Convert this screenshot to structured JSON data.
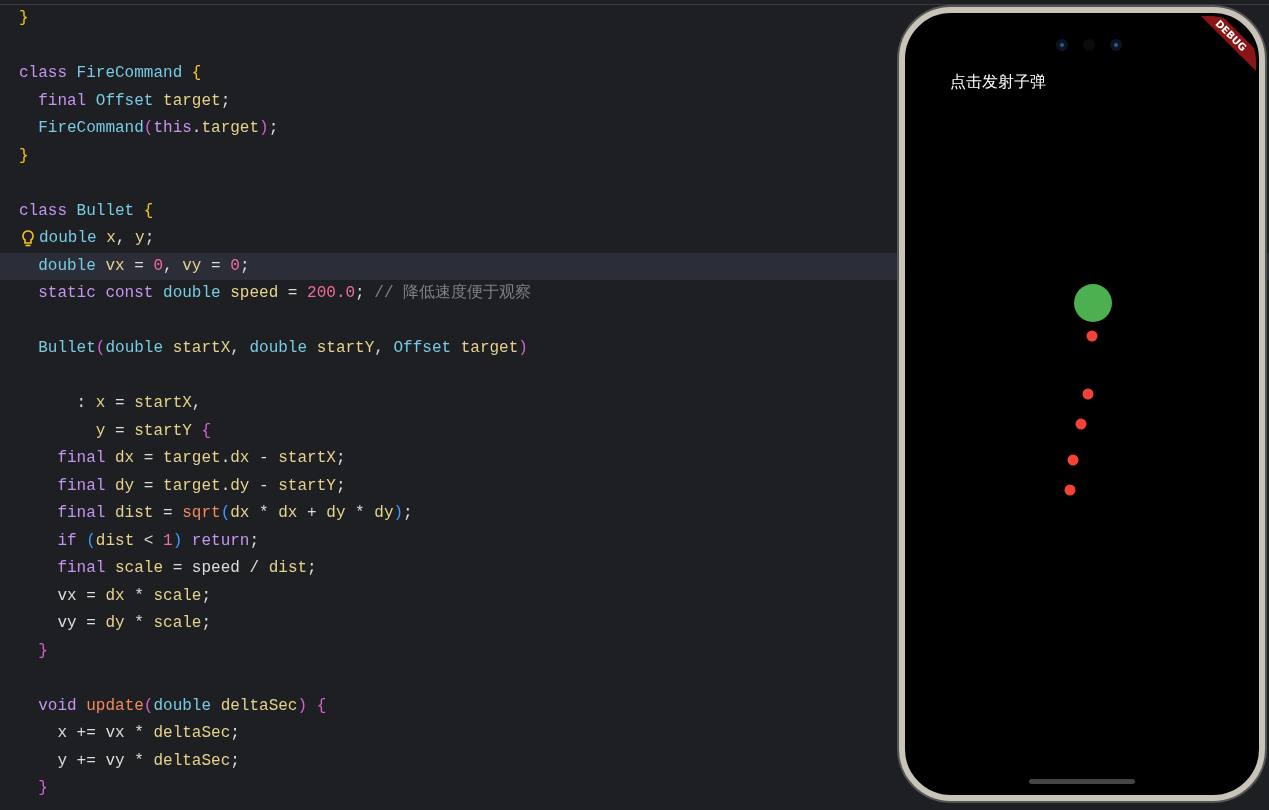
{
  "editor": {
    "lines": [
      {
        "kind": "code",
        "tokens": [
          {
            "t": "}",
            "kind": "brace"
          }
        ]
      },
      {
        "kind": "blank"
      },
      {
        "kind": "code",
        "tokens": [
          {
            "t": "class ",
            "kind": "kw"
          },
          {
            "t": "FireCommand ",
            "kind": "type"
          },
          {
            "t": "{",
            "kind": "brace"
          }
        ]
      },
      {
        "kind": "code",
        "tokens": [
          {
            "t": "  final ",
            "kind": "kw"
          },
          {
            "t": "Offset ",
            "kind": "type"
          },
          {
            "t": "target",
            "kind": "id"
          },
          {
            "t": ";",
            "kind": "plain"
          }
        ]
      },
      {
        "kind": "code",
        "tokens": [
          {
            "t": "  FireCommand",
            "kind": "type"
          },
          {
            "t": "(",
            "kind": "pparen"
          },
          {
            "t": "this",
            "kind": "kw"
          },
          {
            "t": ".",
            "kind": "plain"
          },
          {
            "t": "target",
            "kind": "id"
          },
          {
            "t": ")",
            "kind": "pparen"
          },
          {
            "t": ";",
            "kind": "plain"
          }
        ]
      },
      {
        "kind": "code",
        "tokens": [
          {
            "t": "}",
            "kind": "brace"
          }
        ]
      },
      {
        "kind": "blank"
      },
      {
        "kind": "code",
        "tokens": [
          {
            "t": "class ",
            "kind": "kw"
          },
          {
            "t": "Bullet ",
            "kind": "type"
          },
          {
            "t": "{",
            "kind": "brace"
          }
        ]
      },
      {
        "kind": "code",
        "hint_bulb": true,
        "tokens": [
          {
            "t": "double ",
            "kind": "type"
          },
          {
            "t": "x",
            "kind": "id"
          },
          {
            "t": ", ",
            "kind": "plain"
          },
          {
            "t": "y",
            "kind": "id"
          },
          {
            "t": ";",
            "kind": "plain"
          }
        ]
      },
      {
        "kind": "code",
        "highlighted": true,
        "tokens": [
          {
            "t": "  double ",
            "kind": "type"
          },
          {
            "t": "vx",
            "kind": "id"
          },
          {
            "t": " = ",
            "kind": "plain"
          },
          {
            "t": "0",
            "kind": "num"
          },
          {
            "t": ", ",
            "kind": "plain"
          },
          {
            "t": "vy",
            "kind": "id"
          },
          {
            "t": " = ",
            "kind": "plain"
          },
          {
            "t": "0",
            "kind": "num"
          },
          {
            "t": ";",
            "kind": "plain"
          }
        ]
      },
      {
        "kind": "code",
        "tokens": [
          {
            "t": "  static const ",
            "kind": "kw"
          },
          {
            "t": "double ",
            "kind": "type"
          },
          {
            "t": "speed",
            "kind": "id"
          },
          {
            "t": " = ",
            "kind": "plain"
          },
          {
            "t": "200.0",
            "kind": "num"
          },
          {
            "t": "; ",
            "kind": "plain"
          },
          {
            "t": "// 降低速度便于观察",
            "kind": "cmt"
          }
        ]
      },
      {
        "kind": "blank"
      },
      {
        "kind": "code",
        "tokens": [
          {
            "t": "  Bullet",
            "kind": "type"
          },
          {
            "t": "(",
            "kind": "pparen"
          },
          {
            "t": "double ",
            "kind": "type"
          },
          {
            "t": "startX",
            "kind": "id"
          },
          {
            "t": ", ",
            "kind": "plain"
          },
          {
            "t": "double ",
            "kind": "type"
          },
          {
            "t": "startY",
            "kind": "id"
          },
          {
            "t": ", ",
            "kind": "plain"
          },
          {
            "t": "Offset ",
            "kind": "type"
          },
          {
            "t": "target",
            "kind": "id"
          },
          {
            "t": ")",
            "kind": "pparen"
          }
        ]
      },
      {
        "kind": "blank"
      },
      {
        "kind": "code",
        "tokens": [
          {
            "t": "      : ",
            "kind": "plain"
          },
          {
            "t": "x",
            "kind": "id"
          },
          {
            "t": " = ",
            "kind": "plain"
          },
          {
            "t": "startX",
            "kind": "id"
          },
          {
            "t": ",",
            "kind": "plain"
          }
        ]
      },
      {
        "kind": "code",
        "tokens": [
          {
            "t": "        y",
            "kind": "id"
          },
          {
            "t": " = ",
            "kind": "plain"
          },
          {
            "t": "startY ",
            "kind": "id"
          },
          {
            "t": "{",
            "kind": "pparen"
          }
        ]
      },
      {
        "kind": "code",
        "tokens": [
          {
            "t": "    final ",
            "kind": "kw"
          },
          {
            "t": "dx",
            "kind": "id"
          },
          {
            "t": " = ",
            "kind": "plain"
          },
          {
            "t": "target",
            "kind": "id"
          },
          {
            "t": ".",
            "kind": "plain"
          },
          {
            "t": "dx",
            "kind": "id"
          },
          {
            "t": " - ",
            "kind": "plain"
          },
          {
            "t": "startX",
            "kind": "id"
          },
          {
            "t": ";",
            "kind": "plain"
          }
        ]
      },
      {
        "kind": "code",
        "tokens": [
          {
            "t": "    final ",
            "kind": "kw"
          },
          {
            "t": "dy",
            "kind": "id"
          },
          {
            "t": " = ",
            "kind": "plain"
          },
          {
            "t": "target",
            "kind": "id"
          },
          {
            "t": ".",
            "kind": "plain"
          },
          {
            "t": "dy",
            "kind": "id"
          },
          {
            "t": " - ",
            "kind": "plain"
          },
          {
            "t": "startY",
            "kind": "id"
          },
          {
            "t": ";",
            "kind": "plain"
          }
        ]
      },
      {
        "kind": "code",
        "tokens": [
          {
            "t": "    final ",
            "kind": "kw"
          },
          {
            "t": "dist",
            "kind": "id"
          },
          {
            "t": " = ",
            "kind": "plain"
          },
          {
            "t": "sqrt",
            "kind": "fn"
          },
          {
            "t": "(",
            "kind": "bparen"
          },
          {
            "t": "dx",
            "kind": "id"
          },
          {
            "t": " * ",
            "kind": "plain"
          },
          {
            "t": "dx",
            "kind": "id"
          },
          {
            "t": " + ",
            "kind": "plain"
          },
          {
            "t": "dy",
            "kind": "id"
          },
          {
            "t": " * ",
            "kind": "plain"
          },
          {
            "t": "dy",
            "kind": "id"
          },
          {
            "t": ")",
            "kind": "bparen"
          },
          {
            "t": ";",
            "kind": "plain"
          }
        ]
      },
      {
        "kind": "code",
        "tokens": [
          {
            "t": "    if ",
            "kind": "kw"
          },
          {
            "t": "(",
            "kind": "bparen"
          },
          {
            "t": "dist",
            "kind": "id"
          },
          {
            "t": " < ",
            "kind": "plain"
          },
          {
            "t": "1",
            "kind": "num"
          },
          {
            "t": ") ",
            "kind": "bparen"
          },
          {
            "t": "return",
            "kind": "kw"
          },
          {
            "t": ";",
            "kind": "plain"
          }
        ]
      },
      {
        "kind": "code",
        "tokens": [
          {
            "t": "    final ",
            "kind": "kw"
          },
          {
            "t": "scale",
            "kind": "id"
          },
          {
            "t": " = ",
            "kind": "plain"
          },
          {
            "t": "speed",
            "kind": "plain"
          },
          {
            "t": " / ",
            "kind": "plain"
          },
          {
            "t": "dist",
            "kind": "id"
          },
          {
            "t": ";",
            "kind": "plain"
          }
        ]
      },
      {
        "kind": "code",
        "tokens": [
          {
            "t": "    vx",
            "kind": "plain"
          },
          {
            "t": " = ",
            "kind": "plain"
          },
          {
            "t": "dx",
            "kind": "id"
          },
          {
            "t": " * ",
            "kind": "plain"
          },
          {
            "t": "scale",
            "kind": "id"
          },
          {
            "t": ";",
            "kind": "plain"
          }
        ]
      },
      {
        "kind": "code",
        "tokens": [
          {
            "t": "    vy",
            "kind": "plain"
          },
          {
            "t": " = ",
            "kind": "plain"
          },
          {
            "t": "dy",
            "kind": "id"
          },
          {
            "t": " * ",
            "kind": "plain"
          },
          {
            "t": "scale",
            "kind": "id"
          },
          {
            "t": ";",
            "kind": "plain"
          }
        ]
      },
      {
        "kind": "code",
        "tokens": [
          {
            "t": "  }",
            "kind": "pparen"
          }
        ]
      },
      {
        "kind": "blank"
      },
      {
        "kind": "code",
        "tokens": [
          {
            "t": "  void ",
            "kind": "kw"
          },
          {
            "t": "update",
            "kind": "fn"
          },
          {
            "t": "(",
            "kind": "pparen"
          },
          {
            "t": "double ",
            "kind": "type"
          },
          {
            "t": "deltaSec",
            "kind": "id"
          },
          {
            "t": ") ",
            "kind": "pparen"
          },
          {
            "t": "{",
            "kind": "pparen"
          }
        ]
      },
      {
        "kind": "code",
        "tokens": [
          {
            "t": "    x",
            "kind": "plain"
          },
          {
            "t": " += ",
            "kind": "plain"
          },
          {
            "t": "vx",
            "kind": "plain"
          },
          {
            "t": " * ",
            "kind": "plain"
          },
          {
            "t": "deltaSec",
            "kind": "id"
          },
          {
            "t": ";",
            "kind": "plain"
          }
        ]
      },
      {
        "kind": "code",
        "tokens": [
          {
            "t": "    y",
            "kind": "plain"
          },
          {
            "t": " += ",
            "kind": "plain"
          },
          {
            "t": "vy",
            "kind": "plain"
          },
          {
            "t": " * ",
            "kind": "plain"
          },
          {
            "t": "deltaSec",
            "kind": "id"
          },
          {
            "t": ";",
            "kind": "plain"
          }
        ]
      },
      {
        "kind": "code",
        "tokens": [
          {
            "t": "  }",
            "kind": "pparen"
          }
        ]
      }
    ]
  },
  "phone": {
    "debug_banner": "DEBUG",
    "app": {
      "hint": "点击发射子弹"
    }
  }
}
